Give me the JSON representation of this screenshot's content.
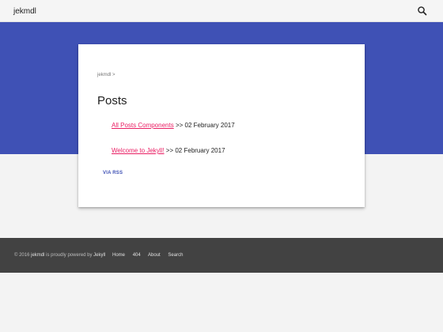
{
  "header": {
    "site_title": "jekmdl",
    "search_icon": "search-icon"
  },
  "colors": {
    "primary": "#3f51b5",
    "accent": "#e91e63",
    "footer_bg": "#424242"
  },
  "breadcrumb": {
    "home": "jekmdl",
    "separator": ">"
  },
  "page": {
    "title": "Posts"
  },
  "posts": [
    {
      "title": "All Posts Components",
      "separator": ">>",
      "date": "02 February 2017"
    },
    {
      "title": "Welcome to Jekyll!",
      "separator": ">>",
      "date": "02 February 2017"
    }
  ],
  "rss": {
    "label": "VIA RSS"
  },
  "footer": {
    "copyright": "© 2016",
    "author": "jekmdl",
    "powered_text": "is proudly powered by",
    "powered_by": "Jekyll",
    "links": [
      "Home",
      "404",
      "About",
      "Search"
    ]
  }
}
